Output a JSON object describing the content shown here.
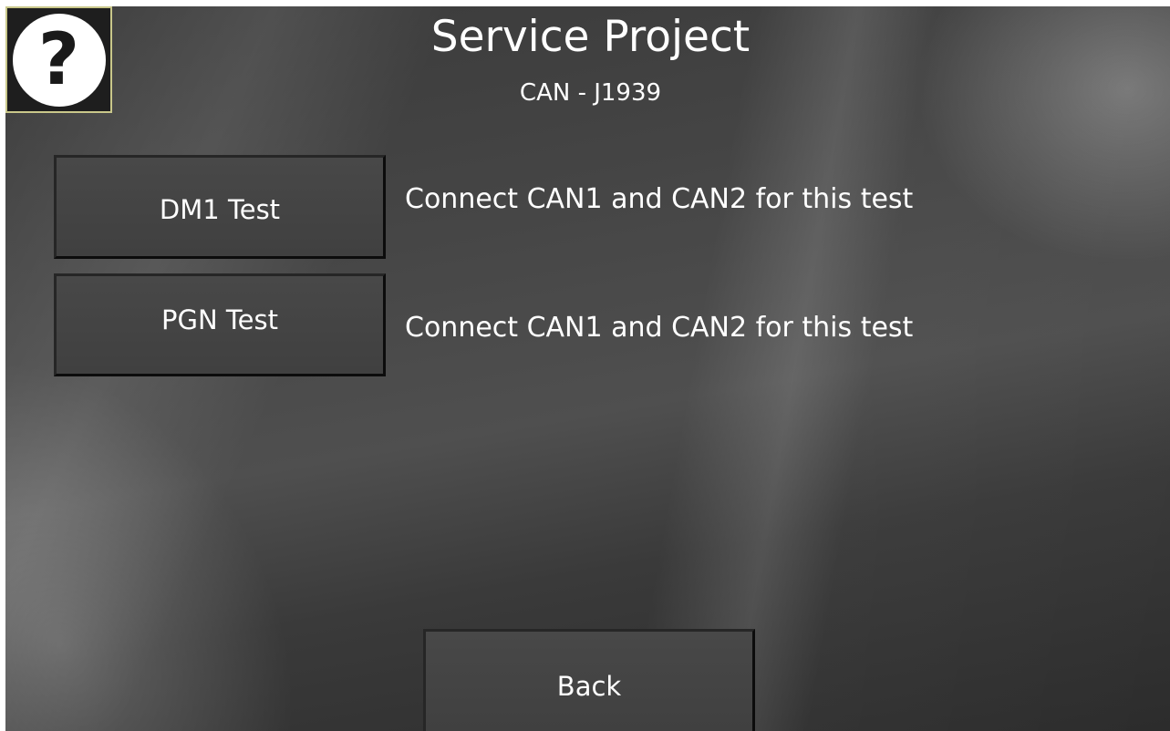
{
  "header": {
    "title": "Service Project",
    "subtitle": "CAN - J1939",
    "help_glyph": "?"
  },
  "tests": [
    {
      "button_label": "DM1 Test",
      "note": "Connect CAN1 and CAN2 for this test"
    },
    {
      "button_label": "PGN Test",
      "note": "Connect CAN1 and CAN2 for this test"
    }
  ],
  "footer": {
    "back_label": "Back"
  },
  "colors": {
    "background": "#3f3f3f",
    "button_face": "#454545",
    "text": "#ffffff",
    "help_border": "#c9c78a"
  },
  "icons": {
    "help": "question-mark-icon"
  }
}
